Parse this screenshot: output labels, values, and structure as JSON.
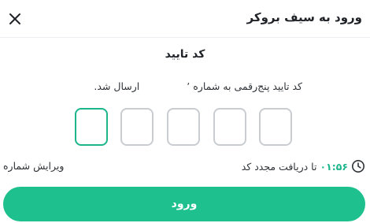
{
  "header": {
    "title": "ورود به سیف بروکر",
    "close_icon": "close-icon"
  },
  "dialog": {
    "title": "کد تایید",
    "instruction_part1": "کد تایید پنج‌رقمی به شماره ‎٬",
    "instruction_part2": "ارسال شد."
  },
  "otp": {
    "length": 5,
    "values": [
      "",
      "",
      "",
      "",
      ""
    ],
    "active_index": 0
  },
  "timer": {
    "icon": "clock-icon",
    "time": "۰۱:۵۶",
    "label": "تا دریافت مجدد کد"
  },
  "edit_number_label": "ویرایش شماره",
  "submit_label": "ورود",
  "colors": {
    "accent": "#1ec08e",
    "timer_text": "#1cb58c",
    "otp_border": "#c9cdd2"
  }
}
